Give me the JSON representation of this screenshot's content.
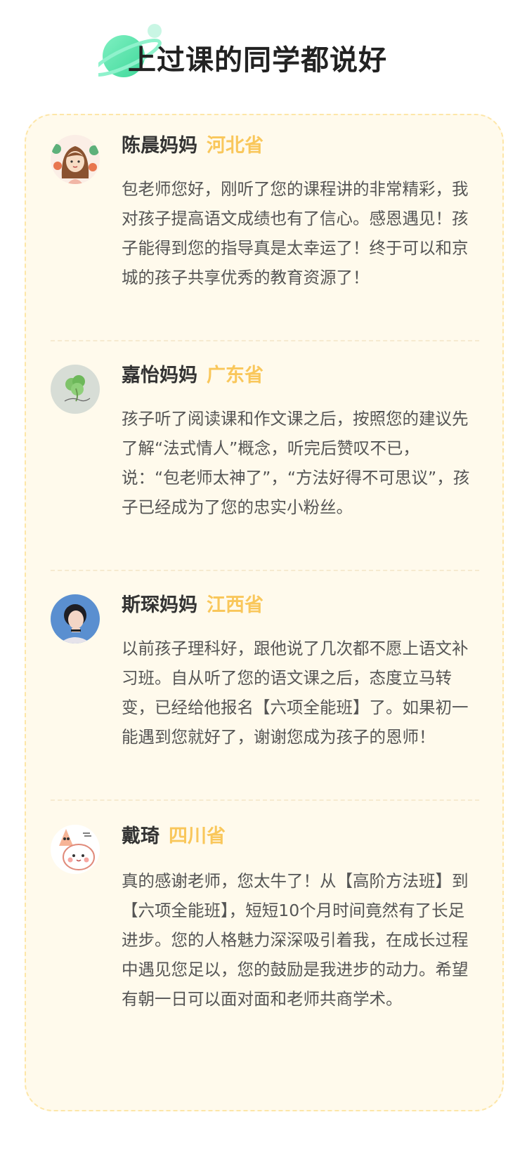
{
  "header": {
    "title": "上过课的同学都说好",
    "decoration_icon": "planet-icon",
    "accent_color": "#5fe3a8"
  },
  "card": {
    "background_color": "#fffaec",
    "province_color": "#f9c75b"
  },
  "reviews": [
    {
      "name": "陈晨妈妈",
      "province": "河北省",
      "avatar_icon": "cartoon-girl-avatar-icon",
      "text": "包老师您好，刚听了您的课程讲的非常精彩，我对孩子提高语文成绩也有了信心。感恩遇见！孩子能得到您的指导真是太幸运了！终于可以和京城的孩子共享优秀的教育资源了！"
    },
    {
      "name": "嘉怡妈妈",
      "province": "广东省",
      "avatar_icon": "clover-avatar-icon",
      "text": "孩子听了阅读课和作文课之后，按照您的建议先了解“法式情人”概念，听完后赞叹不已，说：“包老师太神了”，“方法好得不可思议”，孩子已经成为了您的忠实小粉丝。"
    },
    {
      "name": "斯琛妈妈",
      "province": "江西省",
      "avatar_icon": "woman-photo-avatar-icon",
      "text": "以前孩子理科好，跟他说了几次都不愿上语文补习班。自从听了您的语文课之后，态度立马转变，已经给他报名【六项全能班】了。如果初一能遇到您就好了，谢谢您成为孩子的恩师！"
    },
    {
      "name": "戴琦",
      "province": "四川省",
      "avatar_icon": "cartoon-characters-avatar-icon",
      "text": "真的感谢老师，您太牛了！从【高阶方法班】到【六项全能班】，短短10个月时间竟然有了长足进步。您的人格魅力深深吸引着我，在成长过程中遇见您足以，您的鼓励是我进步的动力。希望有朝一日可以面对面和老师共商学术。"
    }
  ]
}
